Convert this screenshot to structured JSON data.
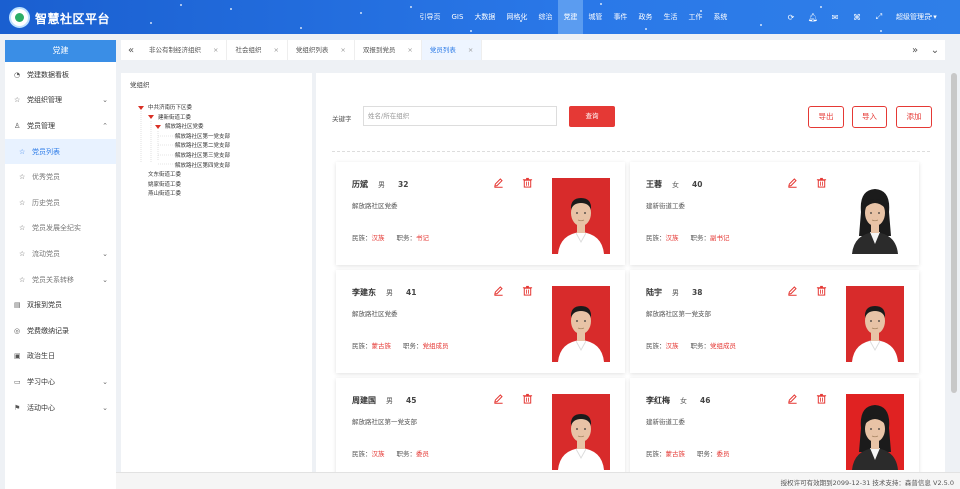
{
  "app": {
    "title": "智慧社区平台",
    "brand_color": "#2a78e8",
    "accent_red": "#e53935"
  },
  "nav": {
    "items": [
      "引导页",
      "GIS",
      "大数据",
      "网格化",
      "综治",
      "党建",
      "城管",
      "事件",
      "政务",
      "生活",
      "工作",
      "系统"
    ],
    "active": "党建",
    "user": "超级管理员"
  },
  "top_icons": [
    "refresh-icon",
    "bell-icon",
    "chat-icon",
    "tag-icon",
    "fullscreen-icon"
  ],
  "sidebar": {
    "header": "党建",
    "items": [
      {
        "label": "党建数据看板",
        "icon": "dashboard-icon",
        "arrow": ""
      },
      {
        "label": "党组织管理",
        "icon": "star-icon",
        "arrow": "down"
      },
      {
        "label": "党员管理",
        "icon": "user-icon",
        "arrow": "up"
      },
      {
        "label": "党员列表",
        "icon": "star-icon",
        "sub": true,
        "active": true
      },
      {
        "label": "优秀党员",
        "icon": "star-icon",
        "sub": true
      },
      {
        "label": "历史党员",
        "icon": "star-icon",
        "sub": true
      },
      {
        "label": "党员发展全纪实",
        "icon": "star-icon",
        "sub": true
      },
      {
        "label": "流动党员",
        "icon": "star-icon",
        "sub": true,
        "arrow": "down"
      },
      {
        "label": "党员关系转移",
        "icon": "star-icon",
        "sub": true,
        "arrow": "down"
      },
      {
        "label": "双报到党员",
        "icon": "file-icon",
        "arrow": ""
      },
      {
        "label": "党费缴纳记录",
        "icon": "coin-icon",
        "arrow": ""
      },
      {
        "label": "政治生日",
        "icon": "gift-icon",
        "arrow": ""
      },
      {
        "label": "学习中心",
        "icon": "book-icon",
        "arrow": "down"
      },
      {
        "label": "活动中心",
        "icon": "flag-icon",
        "arrow": "down"
      }
    ]
  },
  "tabs": [
    {
      "label": "非公有制经济组织",
      "active": false
    },
    {
      "label": "社会组织",
      "active": false
    },
    {
      "label": "党组织列表",
      "active": false
    },
    {
      "label": "双报到党员",
      "active": false
    },
    {
      "label": "党员列表",
      "active": true
    }
  ],
  "org_tree": {
    "title": "党组织",
    "nodes": [
      {
        "label": "中共济南历下区委",
        "level": 0,
        "open": true
      },
      {
        "label": "建新街道工委",
        "level": 1,
        "open": true
      },
      {
        "label": "解放路社区党委",
        "level": 2,
        "open": true
      },
      {
        "label": "解放路社区第一党支部",
        "level": 3
      },
      {
        "label": "解放路社区第二党支部",
        "level": 3
      },
      {
        "label": "解放路社区第三党支部",
        "level": 3
      },
      {
        "label": "解放路社区第四党支部",
        "level": 3
      },
      {
        "label": "文东街道工委",
        "level": 1
      },
      {
        "label": "姚家街道工委",
        "level": 1
      },
      {
        "label": "燕山街道工委",
        "level": 1
      }
    ]
  },
  "search": {
    "label": "关键字",
    "placeholder": "姓名/所在组织",
    "query_label": "查询",
    "export_label": "导出",
    "import_label": "导入",
    "add_label": "添加"
  },
  "members": [
    {
      "name": "历斌",
      "gender": "男",
      "age": "32",
      "org": "解放路社区党委",
      "ethnicity_label": "民族：",
      "ethnicity": "汉族",
      "position_label": "职务：",
      "position": "书记",
      "photo_bg": "#d82b2b",
      "shirt": "#ffffff",
      "hair": "long-female"
    },
    {
      "name": "王蓉",
      "gender": "女",
      "age": "40",
      "org": "建新街道工委",
      "ethnicity_label": "民族：",
      "ethnicity": "汉族",
      "position_label": "职务：",
      "position": "副书记",
      "photo_bg": "#ffffff",
      "shirt": "#2b2b2b"
    },
    {
      "name": "李建东",
      "gender": "男",
      "age": "41",
      "org": "解放路社区党委",
      "ethnicity_label": "民族：",
      "ethnicity": "蒙古族",
      "position_label": "职务：",
      "position": "党组成员",
      "photo_bg": "#d82b2b",
      "shirt": "#ffffff"
    },
    {
      "name": "陆宇",
      "gender": "男",
      "age": "38",
      "org": "解放路社区第一党支部",
      "ethnicity_label": "民族：",
      "ethnicity": "汉族",
      "position_label": "职务：",
      "position": "党组成员",
      "photo_bg": "#d82b2b",
      "shirt": "#ffffff"
    },
    {
      "name": "周建国",
      "gender": "男",
      "age": "45",
      "org": "解放路社区第一党支部",
      "ethnicity_label": "民族：",
      "ethnicity": "汉族",
      "position_label": "职务：",
      "position": "委员",
      "photo_bg": "#d82b2b",
      "shirt": "#ffffff"
    },
    {
      "name": "李红梅",
      "gender": "女",
      "age": "46",
      "org": "建新街道工委",
      "ethnicity_label": "民族：",
      "ethnicity": "蒙古族",
      "position_label": "职务：",
      "position": "委员",
      "photo_bg": "#e02222",
      "shirt": "#2b2b2b"
    }
  ],
  "footer": {
    "text": "授权许可有效期到2099-12-31  技术支持：森普信息  V2.5.0"
  }
}
